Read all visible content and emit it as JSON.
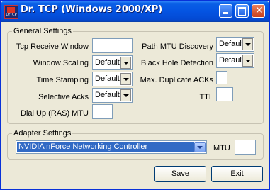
{
  "window": {
    "title": "Dr. TCP (Windows 2000/XP)",
    "icon_label": "DrTCP"
  },
  "general": {
    "legend": "General Settings",
    "tcp_receive_window": {
      "label": "Tcp Receive Window",
      "value": ""
    },
    "window_scaling": {
      "label": "Window Scaling",
      "value": "Default"
    },
    "time_stamping": {
      "label": "Time Stamping",
      "value": "Default"
    },
    "selective_acks": {
      "label": "Selective Acks",
      "value": "Default"
    },
    "dial_up_mtu": {
      "label": "Dial Up (RAS) MTU",
      "value": ""
    },
    "path_mtu_discovery": {
      "label": "Path MTU Discovery",
      "value": "Default"
    },
    "black_hole_detection": {
      "label": "Black Hole Detection",
      "value": "Default"
    },
    "max_duplicate_acks": {
      "label": "Max. Duplicate ACKs",
      "value": ""
    },
    "ttl": {
      "label": "TTL",
      "value": ""
    }
  },
  "adapter": {
    "legend": "Adapter Settings",
    "selected": "NVIDIA nForce Networking Controller",
    "mtu_label": "MTU",
    "mtu_value": ""
  },
  "buttons": {
    "save": "Save",
    "exit": "Exit"
  },
  "icons": {
    "minimize": "minimize-icon",
    "maximize": "maximize-icon",
    "close": "close-icon",
    "dropdown": "chevron-down-icon"
  }
}
